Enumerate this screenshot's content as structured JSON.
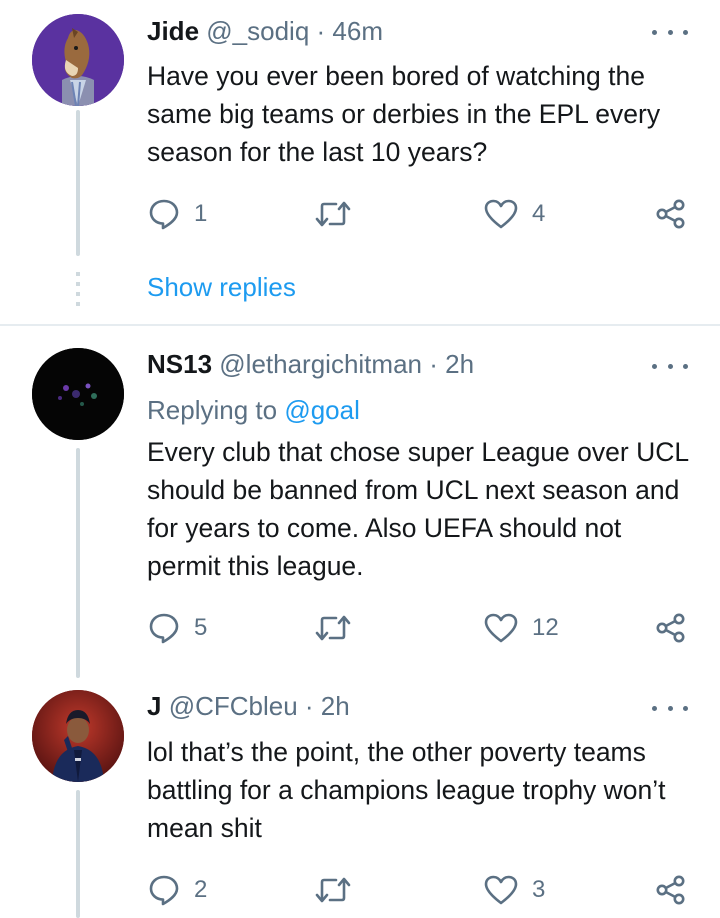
{
  "tweets": [
    {
      "name": "Jide",
      "handle": "@_sodiq",
      "time": "· 46m",
      "text": "Have you ever been bored of watching the same big teams or derbies in the EPL every season for the last 10 years?",
      "replies": "1",
      "retweets": "",
      "likes": "4",
      "avatar": "horse-cartoon-avatar"
    },
    {
      "name": "NS13",
      "handle": "@lethargichitman",
      "time": "· 2h",
      "reply_prefix": "Replying to",
      "reply_to": "@goal",
      "text": "Every club that chose super League over UCL should be banned from UCL next season and for years to come. Also UEFA should not permit this league.",
      "replies": "5",
      "retweets": "",
      "likes": "12",
      "avatar": "dark-avatar"
    },
    {
      "name": "J",
      "handle": "@CFCbleu",
      "time": "· 2h",
      "text": "lol that’s the point, the other poverty teams battling for a champions league trophy won’t mean shit",
      "replies": "2",
      "retweets": "",
      "likes": "3",
      "avatar": "person-avatar"
    }
  ],
  "show_replies": "Show replies",
  "colors": {
    "text": "#14171a",
    "secondary": "#5b7083",
    "link": "#1d9bf0",
    "line": "#cfd9de"
  }
}
